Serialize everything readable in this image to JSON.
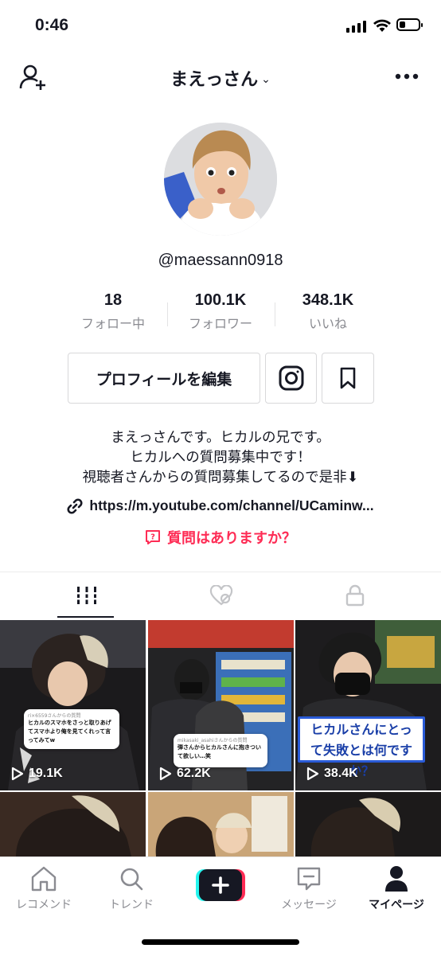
{
  "status": {
    "time": "0:46",
    "battery_level": 0.3
  },
  "header": {
    "title": "まえっさん",
    "icons": [
      "add-user-icon",
      "chevron-down-icon",
      "more-icon"
    ]
  },
  "profile": {
    "username": "@maessann0918",
    "stats": [
      {
        "value": "18",
        "label": "フォロー中"
      },
      {
        "value": "100.1K",
        "label": "フォロワー"
      },
      {
        "value": "348.1K",
        "label": "いいね"
      }
    ],
    "edit_label": "プロフィールを編集",
    "bio": [
      "まえっさんです。ヒカルの兄です。",
      "ヒカルへの質問募集中です！",
      "視聴者さんからの質問募集してるので是非⬇"
    ],
    "link": "https://m.youtube.com/channel/UCaminw...",
    "qa_label": "質問はありますか？"
  },
  "tabs": [
    {
      "name": "videos",
      "icon": "grid-icon",
      "active": true
    },
    {
      "name": "liked",
      "icon": "liked-hidden-icon",
      "active": false
    },
    {
      "name": "private",
      "icon": "lock-icon",
      "active": false
    }
  ],
  "videos": [
    {
      "views": "19.1K",
      "question_from": "ri×6559さんからの質問",
      "question": "ヒカルのスマホをさっと取りあげてスマホより俺を見てくれって言ってみてw"
    },
    {
      "views": "62.2K",
      "question_from": "mikasaki_asahiさんからの質問",
      "question": "弾さんからヒカルさんに抱きついて欲しい…笑"
    },
    {
      "views": "38.4K",
      "question": "ヒカルさんにとって失敗とは何ですか？"
    }
  ],
  "nav": [
    {
      "label": "レコメンド",
      "icon": "home-icon",
      "active": false
    },
    {
      "label": "トレンド",
      "icon": "search-icon",
      "active": false
    },
    {
      "label": "",
      "icon": "plus-icon",
      "active": false
    },
    {
      "label": "メッセージ",
      "icon": "inbox-icon",
      "active": false
    },
    {
      "label": "マイページ",
      "icon": "profile-icon",
      "active": true
    }
  ],
  "colors": {
    "accent": "#fe2c55",
    "text": "#161823",
    "secondary": "#8a8b91",
    "question_border": "#2a5bd7"
  }
}
